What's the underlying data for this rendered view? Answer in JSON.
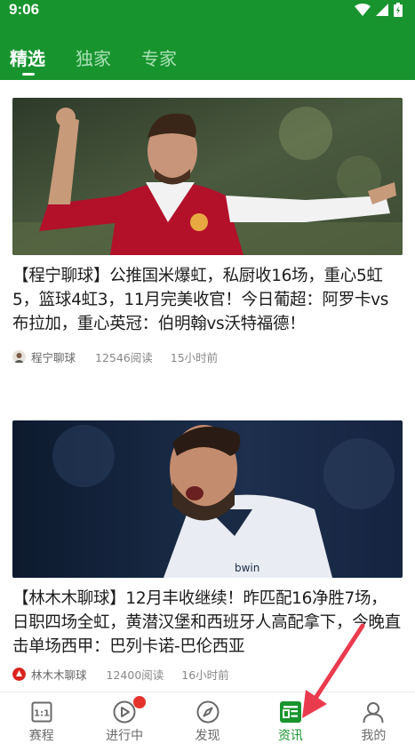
{
  "status": {
    "time": "9:06"
  },
  "tabs": [
    {
      "label": "精选",
      "active": true
    },
    {
      "label": "独家",
      "active": false
    },
    {
      "label": "专家",
      "active": false
    }
  ],
  "articles": [
    {
      "title": "【程宁聊球】公推国米爆虹，私厨收16场，重心5虹5，篮球4虹3，11月完美收官！今日葡超：阿罗卡vs布拉加，重心英冠：伯明翰vs沃特福德！",
      "author": "程宁聊球",
      "reads": "12546阅读",
      "time": "15小时前"
    },
    {
      "title": "【林木木聊球】12月丰收继续！昨匹配16净胜7场，日职四场全虹，黄潜汉堡和西班牙人高配拿下，今晚直击单场西甲：巴列卡诺-巴伦西亚",
      "author": "林木木聊球",
      "reads": "12400阅读",
      "time": "16小时前"
    }
  ],
  "nav": [
    {
      "label": "赛程",
      "icon": "schedule-icon",
      "active": false
    },
    {
      "label": "进行中",
      "icon": "play-icon",
      "active": false
    },
    {
      "label": "发现",
      "icon": "compass-icon",
      "active": false
    },
    {
      "label": "资讯",
      "icon": "news-icon",
      "active": true
    },
    {
      "label": "我的",
      "icon": "user-icon",
      "active": false
    }
  ],
  "colors": {
    "brand": "#18942f",
    "badge": "#e5322d",
    "arrow": "#ea3b4e"
  }
}
